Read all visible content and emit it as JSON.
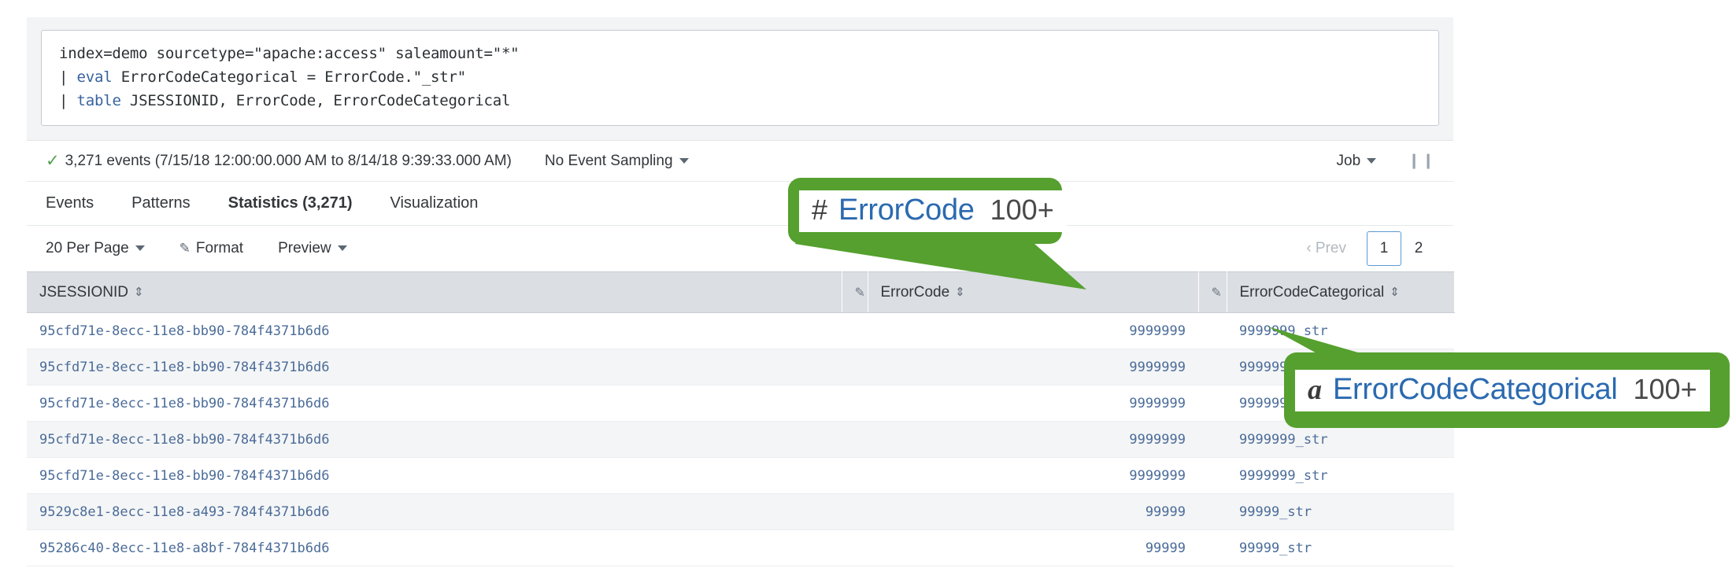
{
  "search": {
    "query_lines": [
      {
        "pipe": "",
        "command": "",
        "rest": "index=demo sourcetype=\"apache:access\" saleamount=\"*\""
      },
      {
        "pipe": "| ",
        "command": "eval",
        "rest": " ErrorCodeCategorical = ErrorCode.\"_str\""
      },
      {
        "pipe": "| ",
        "command": "table",
        "rest": " JSESSIONID, ErrorCode, ErrorCodeCategorical"
      }
    ]
  },
  "status": {
    "check_icon": "check-icon",
    "events_summary": "3,271 events (7/15/18 12:00:00.000 AM to 8/14/18 9:39:33.000 AM)",
    "sampling_label": "No Event Sampling",
    "job_label": "Job",
    "pause_icon": "pause-icon",
    "pause_glyph": "❙❙"
  },
  "tabs": [
    {
      "label": "Events",
      "active": false
    },
    {
      "label": "Patterns",
      "active": false
    },
    {
      "label": "Statistics (3,271)",
      "active": true
    },
    {
      "label": "Visualization",
      "active": false
    }
  ],
  "toolbar": {
    "per_page_label": "20 Per Page",
    "format_label": "Format",
    "preview_label": "Preview",
    "format_icon": "pencil-icon",
    "pagination": {
      "prev_label": "Prev",
      "prev_icon": "chevron-left-icon",
      "pages": [
        "1",
        "2"
      ],
      "current_page": "1"
    }
  },
  "table": {
    "columns": [
      {
        "label": "JSESSIONID",
        "sortable": true,
        "align": "left"
      },
      {
        "label": "",
        "sortable": false,
        "align": "center",
        "icon": "pencil-icon"
      },
      {
        "label": "ErrorCode",
        "sortable": true,
        "align": "right"
      },
      {
        "label": "",
        "sortable": false,
        "align": "center",
        "icon": "pencil-icon"
      },
      {
        "label": "ErrorCodeCategorical",
        "sortable": true,
        "align": "left"
      }
    ],
    "rows": [
      {
        "jsessionid": "95cfd71e-8ecc-11e8-bb90-784f4371b6d6",
        "errorcode": "9999999",
        "errorcodecategorical": "9999999_str"
      },
      {
        "jsessionid": "95cfd71e-8ecc-11e8-bb90-784f4371b6d6",
        "errorcode": "9999999",
        "errorcodecategorical": "9999999_str"
      },
      {
        "jsessionid": "95cfd71e-8ecc-11e8-bb90-784f4371b6d6",
        "errorcode": "9999999",
        "errorcodecategorical": "9999999_str"
      },
      {
        "jsessionid": "95cfd71e-8ecc-11e8-bb90-784f4371b6d6",
        "errorcode": "9999999",
        "errorcodecategorical": "9999999_str"
      },
      {
        "jsessionid": "95cfd71e-8ecc-11e8-bb90-784f4371b6d6",
        "errorcode": "9999999",
        "errorcodecategorical": "9999999_str"
      },
      {
        "jsessionid": "9529c8e1-8ecc-11e8-a493-784f4371b6d6",
        "errorcode": "99999",
        "errorcodecategorical": "99999_str"
      },
      {
        "jsessionid": "95286c40-8ecc-11e8-a8bf-784f4371b6d6",
        "errorcode": "99999",
        "errorcodecategorical": "99999_str"
      }
    ]
  },
  "callouts": [
    {
      "symbol": "#",
      "symbol_style": "hash",
      "field_name": "ErrorCode",
      "count": "100+",
      "color": "#55a02e"
    },
    {
      "symbol": "a",
      "symbol_style": "italic",
      "field_name": "ErrorCodeCategorical",
      "count": "100+",
      "color": "#55a02e"
    }
  ]
}
